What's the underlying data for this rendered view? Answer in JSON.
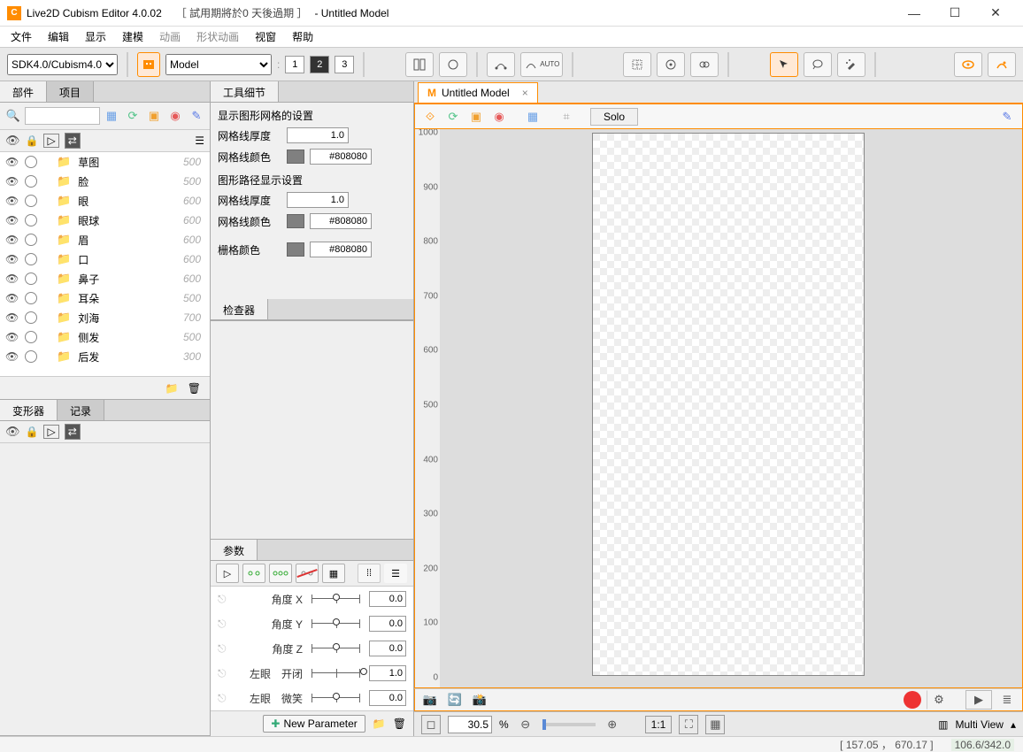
{
  "title": {
    "app": "Live2D Cubism Editor 4.0.02",
    "trial": "［ 試用期將於0 天後過期 ］",
    "doc": "- Untitled Model"
  },
  "menu": [
    "文件",
    "编辑",
    "显示",
    "建模",
    "动画",
    "形状动画",
    "视窗",
    "帮助"
  ],
  "toolbar": {
    "sdk": "SDK4.0/Cubism4.0",
    "mode": "Model",
    "nums": [
      "1",
      "2",
      "3"
    ]
  },
  "parts": {
    "tabs": [
      "部件",
      "项目"
    ],
    "items": [
      {
        "name": "草图",
        "cnt": "500"
      },
      {
        "name": "脸",
        "cnt": "500"
      },
      {
        "name": "眼",
        "cnt": "600"
      },
      {
        "name": "眼球",
        "cnt": "600"
      },
      {
        "name": "眉",
        "cnt": "600"
      },
      {
        "name": "口",
        "cnt": "600"
      },
      {
        "name": "鼻子",
        "cnt": "600"
      },
      {
        "name": "耳朵",
        "cnt": "500"
      },
      {
        "name": "刘海",
        "cnt": "700"
      },
      {
        "name": "侧发",
        "cnt": "500"
      },
      {
        "name": "后发",
        "cnt": "300"
      }
    ]
  },
  "deformer": {
    "tabs": [
      "变形器",
      "记录"
    ]
  },
  "tooldetail": {
    "title": "工具细节",
    "g1": "显示图形网格的设置",
    "thickness_lbl": "网格线厚度",
    "thickness_val": "1.0",
    "color_lbl": "网格线颜色",
    "color_val": "#808080",
    "g2": "图形路径显示设置",
    "thickness2_val": "1.0",
    "color2_val": "#808080",
    "grid_lbl": "栅格颜色",
    "grid_val": "#808080"
  },
  "inspector": {
    "title": "检查器"
  },
  "params": {
    "title": "参数",
    "items": [
      {
        "name": "角度 X",
        "val": "0.0",
        "knob": 50
      },
      {
        "name": "角度 Y",
        "val": "0.0",
        "knob": 50
      },
      {
        "name": "角度 Z",
        "val": "0.0",
        "knob": 50
      },
      {
        "name": "左眼　开闭",
        "val": "1.0",
        "knob": 100
      },
      {
        "name": "左眼　微笑",
        "val": "0.0",
        "knob": 50
      }
    ],
    "newbtn": "New Parameter"
  },
  "canvas": {
    "tab": "Untitled Model",
    "solo": "Solo",
    "ruler": [
      "1000",
      "900",
      "800",
      "700",
      "600",
      "500",
      "400",
      "300",
      "200",
      "100",
      "0"
    ],
    "zoom": "30.5",
    "zoompct": "%",
    "multiview": "Multi View",
    "ratio": "1:1"
  },
  "status": {
    "coords": "[   157.05 ，  670.17  ]",
    "mem": "106.6/342.0"
  }
}
